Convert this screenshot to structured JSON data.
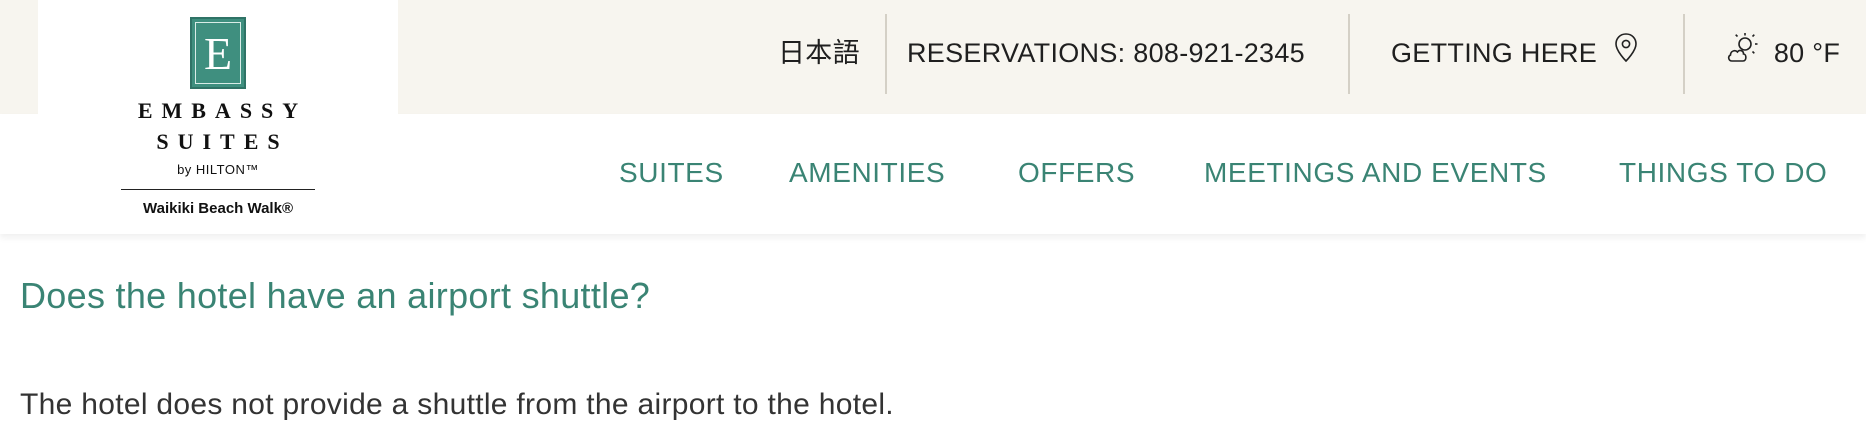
{
  "brand": {
    "name_line1": "EMBASSY",
    "name_line2": "SUITES",
    "by_line": "by HILTON™",
    "location": "Waikiki Beach Walk®",
    "mark_letter": "E",
    "mark_color": "#3f8f7f"
  },
  "utility_bar": {
    "language": "日本語",
    "reservations": "RESERVATIONS: 808-921-2345",
    "getting_here": "GETTING HERE",
    "getting_here_icon": "map-pin-icon",
    "weather_icon": "partly-sunny-icon",
    "temperature": "80 °F"
  },
  "nav": {
    "items": [
      {
        "label": "SUITES"
      },
      {
        "label": "AMENITIES"
      },
      {
        "label": "OFFERS"
      },
      {
        "label": "MEETINGS AND EVENTS"
      },
      {
        "label": "THINGS TO DO"
      }
    ],
    "color": "#3a8474"
  },
  "faq": {
    "question": "Does the hotel have an airport shuttle?",
    "answer": "The hotel does not provide a shuttle from the airport to the hotel."
  }
}
